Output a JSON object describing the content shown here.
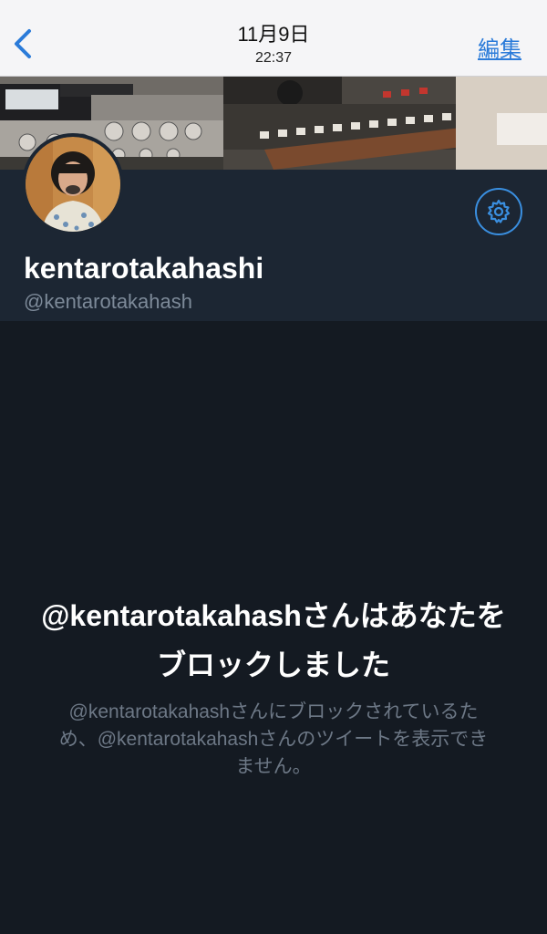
{
  "nav": {
    "date": "11月9日",
    "time": "22:37",
    "edit_label": "編集",
    "back_icon": "chevron-left-icon"
  },
  "profile": {
    "display_name": "kentarotakahashi",
    "handle": "@kentarotakahash",
    "settings_icon": "gear-icon"
  },
  "blocked": {
    "title": "@kentarotakahashさんはあなたをブロックしました",
    "description": "@kentarotakahashさんにブロックされているため、@kentarotakahashさんのツイートを表示できません。"
  },
  "colors": {
    "accent": "#3a8fe0",
    "link": "#2b7bd9",
    "background": "#141a22",
    "profile_panel": "#1c2633"
  }
}
